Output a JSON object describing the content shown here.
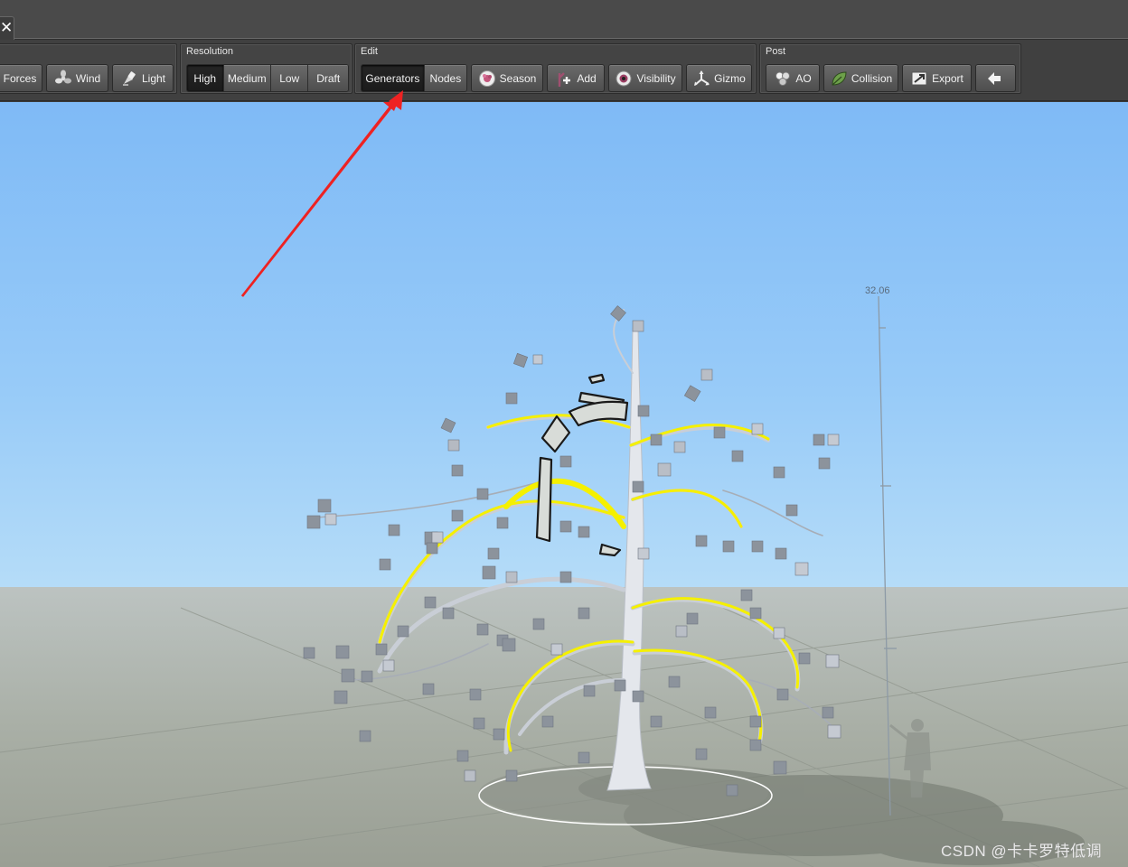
{
  "window": {
    "close_glyph": "✕"
  },
  "toolbar": {
    "groups": {
      "view": {
        "buttons": [
          {
            "label": "Forces"
          },
          {
            "label": "Wind"
          },
          {
            "label": "Light"
          }
        ]
      },
      "resolution": {
        "label": "Resolution",
        "options": [
          {
            "label": "High",
            "active": true
          },
          {
            "label": "Medium"
          },
          {
            "label": "Low"
          },
          {
            "label": "Draft"
          }
        ]
      },
      "edit": {
        "label": "Edit",
        "modes": [
          {
            "label": "Generators",
            "active": true
          },
          {
            "label": "Nodes"
          }
        ],
        "buttons": [
          {
            "label": "Season"
          },
          {
            "label": "Add"
          },
          {
            "label": "Visibility"
          },
          {
            "label": "Gizmo"
          }
        ]
      },
      "post": {
        "label": "Post",
        "buttons": [
          {
            "label": "AO"
          },
          {
            "label": "Collision"
          },
          {
            "label": "Export"
          },
          {
            "label": ""
          }
        ]
      }
    }
  },
  "viewport": {
    "height_marker": "32.06",
    "watermark": "CSDN @卡卡罗特低调",
    "colors": {
      "selection": "#f5f000",
      "annotation_arrow": "#ee2222",
      "sky": "#88c2f7",
      "ground": "#a9afa6"
    }
  }
}
